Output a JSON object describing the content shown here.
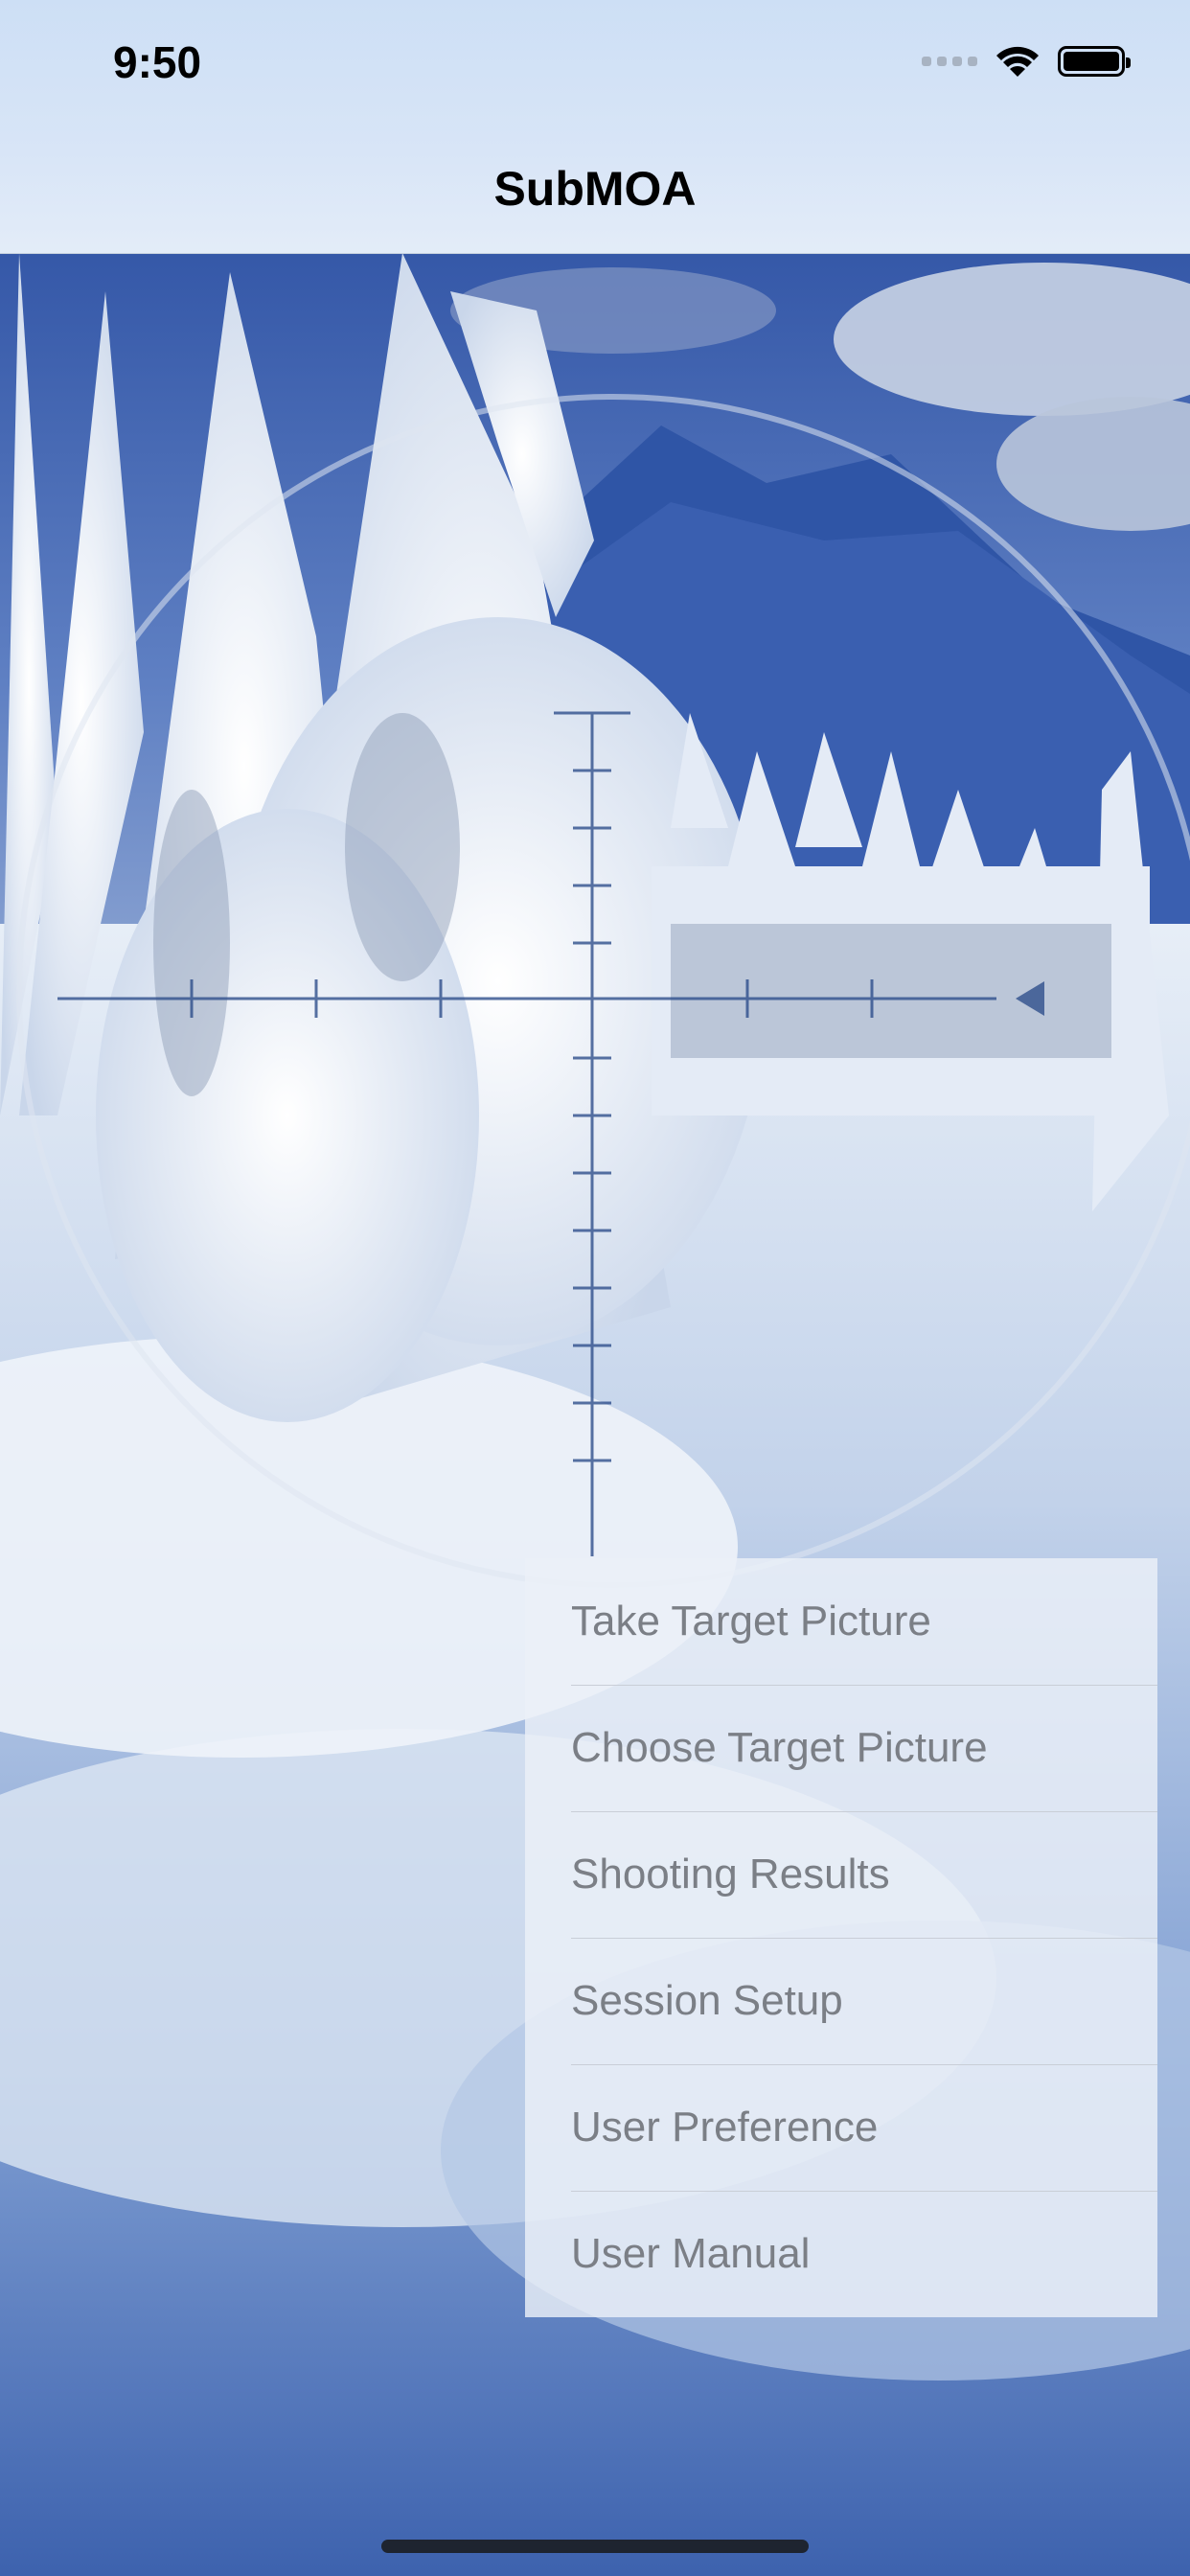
{
  "status_bar": {
    "time": "9:50"
  },
  "nav": {
    "title": "SubMOA"
  },
  "menu": {
    "items": [
      {
        "label": "Take Target Picture"
      },
      {
        "label": "Choose Target Picture"
      },
      {
        "label": "Shooting Results"
      },
      {
        "label": "Session Setup"
      },
      {
        "label": "User Preference"
      },
      {
        "label": "User Manual"
      }
    ]
  },
  "colors": {
    "menu_text": "#7b7f86",
    "sky": "#3f64b0",
    "snow": "#e6edf6"
  },
  "icons": [
    "wifi-icon",
    "battery-icon",
    "cellular-signal-icon",
    "scope-reticle"
  ]
}
